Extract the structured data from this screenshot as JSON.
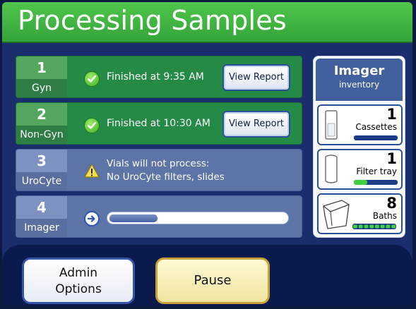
{
  "header": {
    "title": "Processing Samples"
  },
  "rows": [
    {
      "number": "1",
      "label": "Gyn",
      "status": "Finished at  9:35 AM",
      "button": "View Report"
    },
    {
      "number": "2",
      "label": "Non-Gyn",
      "status": "Finished at 10:30 AM",
      "button": "View Report"
    },
    {
      "number": "3",
      "label": "UroCyte",
      "status_line1": "Vials will not process:",
      "status_line2": "No UroCyte filters, slides"
    },
    {
      "number": "4",
      "label": "Imager",
      "progress": 0.27
    }
  ],
  "imager": {
    "title": "Imager",
    "subtitle": "inventory",
    "cassettes": {
      "count": "1",
      "name": "Cassettes",
      "level": 0.0
    },
    "filter_tray": {
      "count": "1",
      "name": "Filter tray",
      "level": 0.3
    },
    "baths": {
      "count": "8",
      "name": "Baths",
      "filled": 8,
      "total": 8
    }
  },
  "footer": {
    "admin_line1": "Admin",
    "admin_line2": "Options",
    "pause": "Pause"
  },
  "colors": {
    "header_green": "#3eae40",
    "finished_green": "#258a45",
    "pending_blue": "#5d74a6",
    "panel_navy": "#1a2e6e"
  }
}
